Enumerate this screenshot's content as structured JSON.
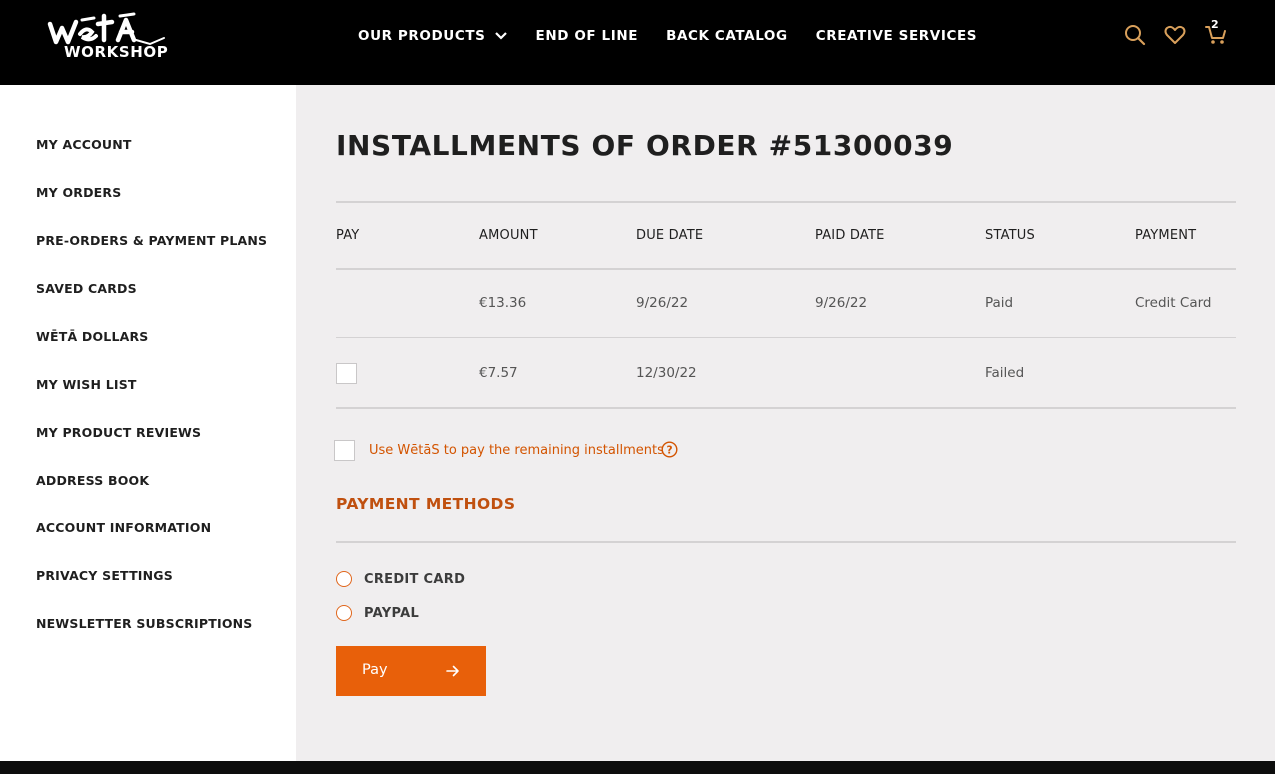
{
  "header": {
    "logo": {
      "brand": "Wētā",
      "sub": "WORKSHOP"
    },
    "nav": [
      {
        "label": "OUR PRODUCTS",
        "has_dropdown": true
      },
      {
        "label": "END OF LINE"
      },
      {
        "label": "BACK CATALOG"
      },
      {
        "label": "CREATIVE SERVICES"
      }
    ],
    "icons": [
      "search-icon",
      "heart-icon",
      "cart-icon"
    ],
    "cart_count": "2",
    "icon_color": "#d9a05b"
  },
  "sidebar": {
    "items": [
      {
        "label": "MY ACCOUNT"
      },
      {
        "label": "MY ORDERS"
      },
      {
        "label": "PRE-ORDERS & PAYMENT PLANS"
      },
      {
        "label": "SAVED CARDS"
      },
      {
        "label": "WĒTĀ DOLLARS"
      },
      {
        "label": "MY WISH LIST"
      },
      {
        "label": "MY PRODUCT REVIEWS"
      },
      {
        "label": "ADDRESS BOOK"
      },
      {
        "label": "ACCOUNT INFORMATION"
      },
      {
        "label": "PRIVACY SETTINGS"
      },
      {
        "label": "NEWSLETTER SUBSCRIPTIONS"
      }
    ]
  },
  "main": {
    "title": "INSTALLMENTS OF ORDER #51300039",
    "table": {
      "headers": [
        "PAY",
        "AMOUNT",
        "DUE DATE",
        "PAID DATE",
        "STATUS",
        "PAYMENT"
      ],
      "rows": [
        {
          "pay": "",
          "amount": "€13.36",
          "due_date": "9/26/22",
          "paid_date": "9/26/22",
          "status": "Paid",
          "payment": "Credit Card"
        },
        {
          "pay": "checkbox",
          "amount": "€7.57",
          "due_date": "12/30/22",
          "paid_date": "",
          "status": "Failed",
          "payment": ""
        }
      ]
    },
    "use_wetas_label": "Use WētāS to pay the remaining installments",
    "payment_methods": {
      "title": "PAYMENT METHODS",
      "options": [
        {
          "label": "CREDIT CARD",
          "selected": false
        },
        {
          "label": "PAYPAL",
          "selected": false
        }
      ]
    },
    "pay_button": "Pay",
    "accent_color": "#e8600a"
  }
}
